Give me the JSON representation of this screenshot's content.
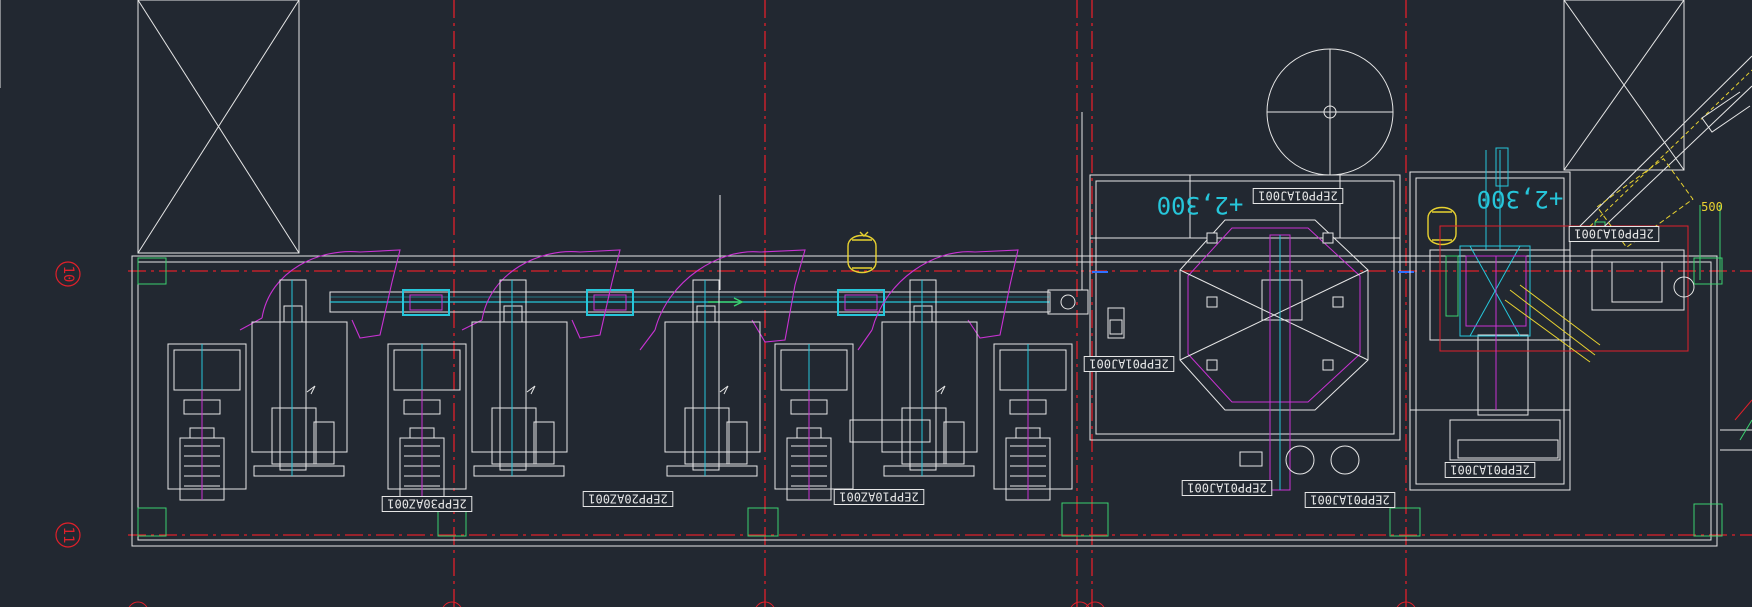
{
  "drawing": {
    "background": "#222831",
    "colors": {
      "outline": "#e6e6e6",
      "grid_line": "#e0202a",
      "cyan": "#26c6da",
      "magenta": "#c832d2",
      "yellow": "#e8d230",
      "green": "#3bd16f",
      "blue": "#3070ff",
      "red_box": "#e0202a"
    },
    "grid_bubbles": [
      {
        "id": "row-10",
        "label": "10"
      },
      {
        "id": "row-11",
        "label": "11"
      }
    ],
    "elevations": [
      {
        "id": "elev-left",
        "label": "+2,300"
      },
      {
        "id": "elev-right",
        "label": "+2,300"
      }
    ],
    "dimension": {
      "label": "500"
    },
    "equipment_tags": [
      "2EPP01AJ001",
      "2EPP01AJ001",
      "2EPP01AJ001",
      "2EPP01AJ001",
      "2EPP01AJ001",
      "2EPP01AJ001",
      "2EPP30AZ001",
      "2EPP20AZ001",
      "2EPP10AZ001"
    ]
  }
}
